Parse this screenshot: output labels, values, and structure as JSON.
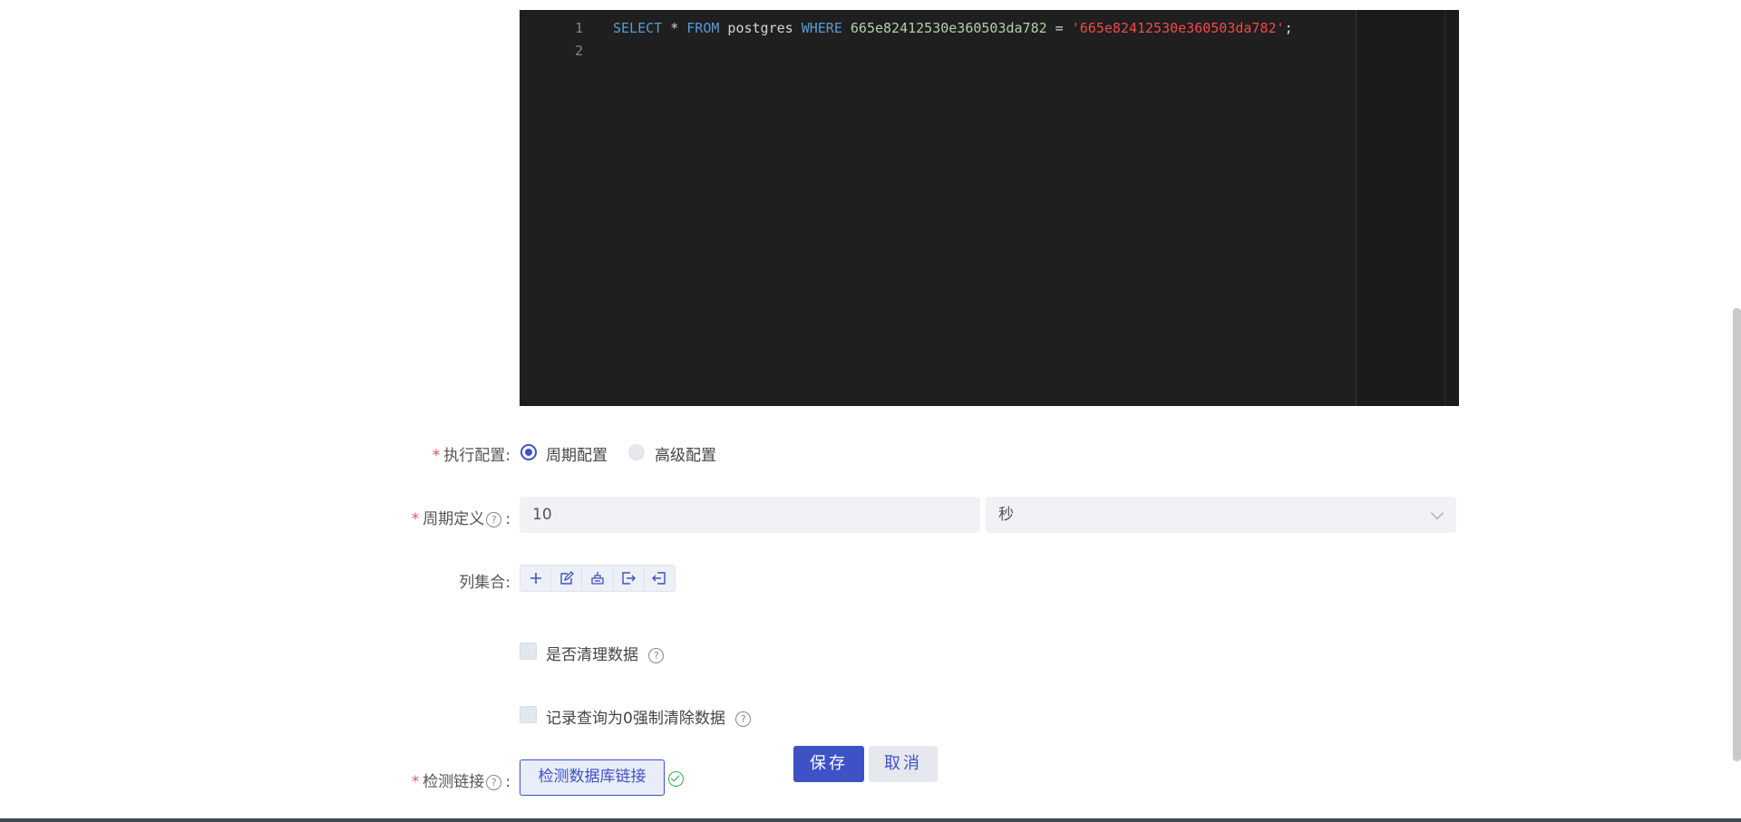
{
  "editor": {
    "line_numbers": [
      "1",
      "2"
    ],
    "sql": {
      "kw_select": "SELECT",
      "star": " * ",
      "kw_from": "FROM",
      "table": " postgres ",
      "kw_where": "WHERE",
      "column": " 665e82412530e360503da782",
      "eq": " = ",
      "value": "'665e82412530e360503da782'",
      "semi": ";"
    }
  },
  "exec_config": {
    "label": "执行配置:",
    "options": [
      "周期配置",
      "高级配置"
    ],
    "selected": "周期配置"
  },
  "period": {
    "label": "周期定义",
    "colon": ":",
    "value": "10",
    "unit": "秒"
  },
  "columns": {
    "label": "列集合:",
    "tools": [
      "add-icon",
      "edit-icon",
      "group-icon",
      "export-icon",
      "import-icon"
    ]
  },
  "options": {
    "clear_data": "是否清理数据",
    "force_clear": "记录查询为0强制清除数据"
  },
  "check_link": {
    "label": "检测链接",
    "colon": ":",
    "button": "检测数据库链接"
  },
  "actions": {
    "save": "保存",
    "cancel": "取消"
  },
  "colors": {
    "accent": "#3d52c4",
    "required": "#e55353",
    "success": "#2bab4f",
    "editor_bg": "#1f1f1f"
  }
}
